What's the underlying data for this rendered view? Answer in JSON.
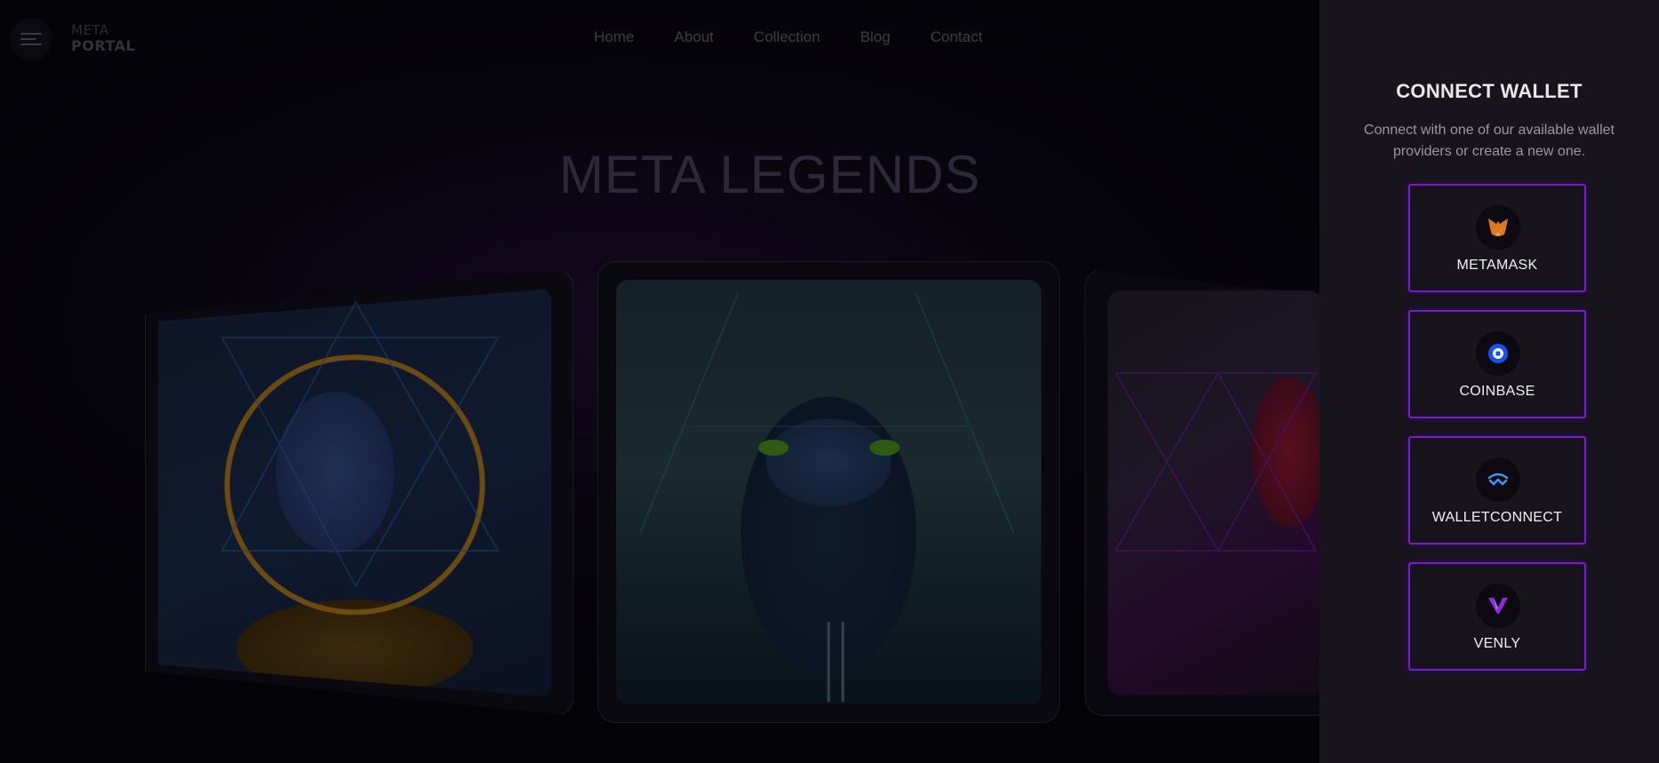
{
  "header": {
    "logo_line1": "META",
    "logo_line2": "PORTAL",
    "nav": [
      "Home",
      "About",
      "Collection",
      "Blog",
      "Contact"
    ]
  },
  "hero": {
    "title": "META LEGENDS"
  },
  "wallet_panel": {
    "title": "CONNECT WALLET",
    "description": "Connect with one of our available wallet providers or create a new one.",
    "providers": [
      {
        "label": "METAMASK",
        "icon": "metamask-fox-icon",
        "color": "#f6851b"
      },
      {
        "label": "COINBASE",
        "icon": "coinbase-icon",
        "color": "#1652f0"
      },
      {
        "label": "WALLETCONNECT",
        "icon": "walletconnect-icon",
        "color": "#3b99fc"
      },
      {
        "label": "VENLY",
        "icon": "venly-icon",
        "color": "#8a2be2"
      }
    ],
    "accent_color": "#7b18d9"
  }
}
